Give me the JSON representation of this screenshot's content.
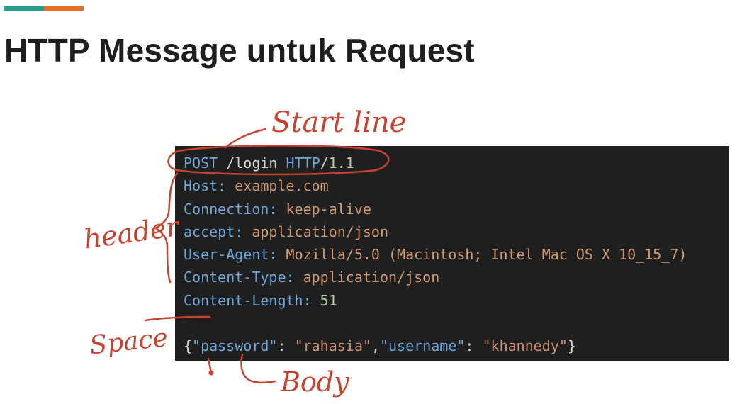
{
  "slide": {
    "title": "HTTP Message untuk Request"
  },
  "colors": {
    "accent_teal": "#2a9d8f",
    "accent_orange": "#e76f2a",
    "code_background": "#1e1f1e",
    "code_key": "#6fa8dc",
    "code_value": "#d19a74",
    "code_number": "#b5cea8",
    "annotation_ink": "#c8422f"
  },
  "request": {
    "start_line": {
      "method": "POST",
      "path": " /login ",
      "protocol": "HTTP",
      "slash": "/",
      "version": "1.1"
    },
    "headers": [
      {
        "name": "Host:",
        "value": " example.com"
      },
      {
        "name": "Connection:",
        "value": " keep-alive"
      },
      {
        "name": "accept:",
        "value": " application/json"
      },
      {
        "name": "User-Agent:",
        "value": " Mozilla/5.0 (Macintosh; Intel Mac OS X 10_15_7)"
      },
      {
        "name": "Content-Type:",
        "value": " application/json"
      },
      {
        "name": "Content-Length:",
        "value": " 51"
      }
    ],
    "body": {
      "open_brace": "{",
      "key1": "\"password\"",
      "colon1": ": ",
      "value1": "\"rahasia\"",
      "comma": ",",
      "key2": "\"username\"",
      "colon2": ": ",
      "value2": "\"khannedy\"",
      "close_brace": "}"
    }
  },
  "annotations": {
    "start_line": "Start line",
    "header": "header",
    "space": "Space",
    "body": "Body"
  }
}
